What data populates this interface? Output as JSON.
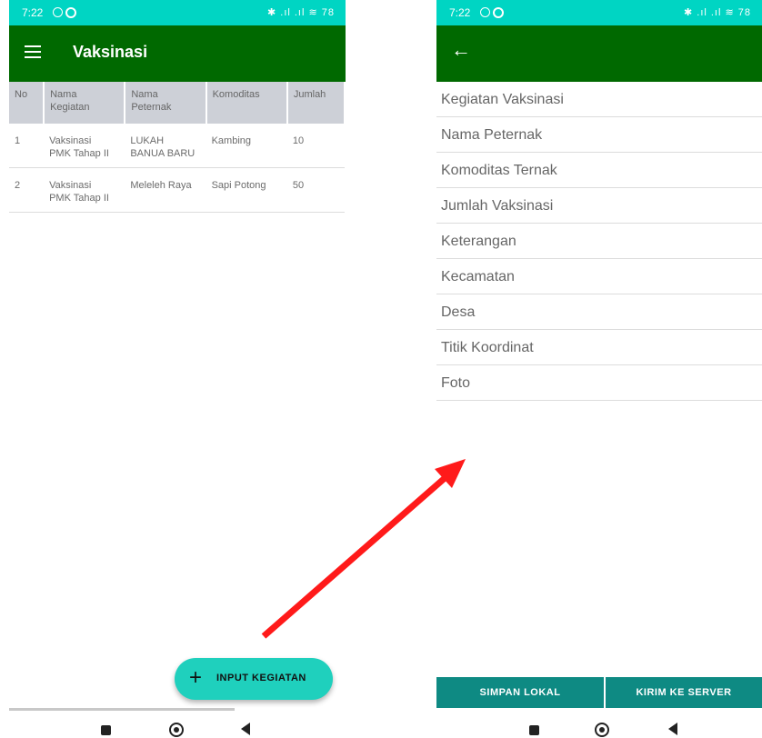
{
  "left_screen": {
    "status": {
      "time": "7:22",
      "icons": "✱ .ıl .ıl ≋ 78"
    },
    "appbar": {
      "title": "Vaksinasi"
    },
    "table": {
      "headers": [
        "No",
        "Nama\nKegiatan",
        "Nama\nPeternak",
        "Komoditas",
        "Jumlah"
      ],
      "rows": [
        [
          "1",
          "Vaksinasi\nPMK Tahap II",
          "LUKAH\nBANUA BARU",
          "Kambing",
          "10"
        ],
        [
          "2",
          "Vaksinasi\nPMK Tahap II",
          "Meleleh Raya",
          "Sapi Potong",
          "50"
        ]
      ]
    },
    "fab": {
      "icon": "plus-icon",
      "label": "INPUT KEGIATAN"
    }
  },
  "right_screen": {
    "status": {
      "time": "7:22",
      "icons": "✱ .ıl .ıl ≋ 78"
    },
    "form_fields": [
      "Kegiatan Vaksinasi",
      "Nama Peternak",
      "Komoditas Ternak",
      "Jumlah Vaksinasi",
      "Keterangan",
      "Kecamatan",
      "Desa",
      "Titik Koordinat",
      "Foto"
    ],
    "buttons": {
      "save_local": "SIMPAN LOKAL",
      "send_server": "KIRIM KE SERVER"
    }
  },
  "colors": {
    "statusbar": "#00d5c3",
    "appbar": "#006900",
    "fab": "#1fd0bd",
    "button": "#0e8a83",
    "arrow": "#ff1a1a"
  }
}
